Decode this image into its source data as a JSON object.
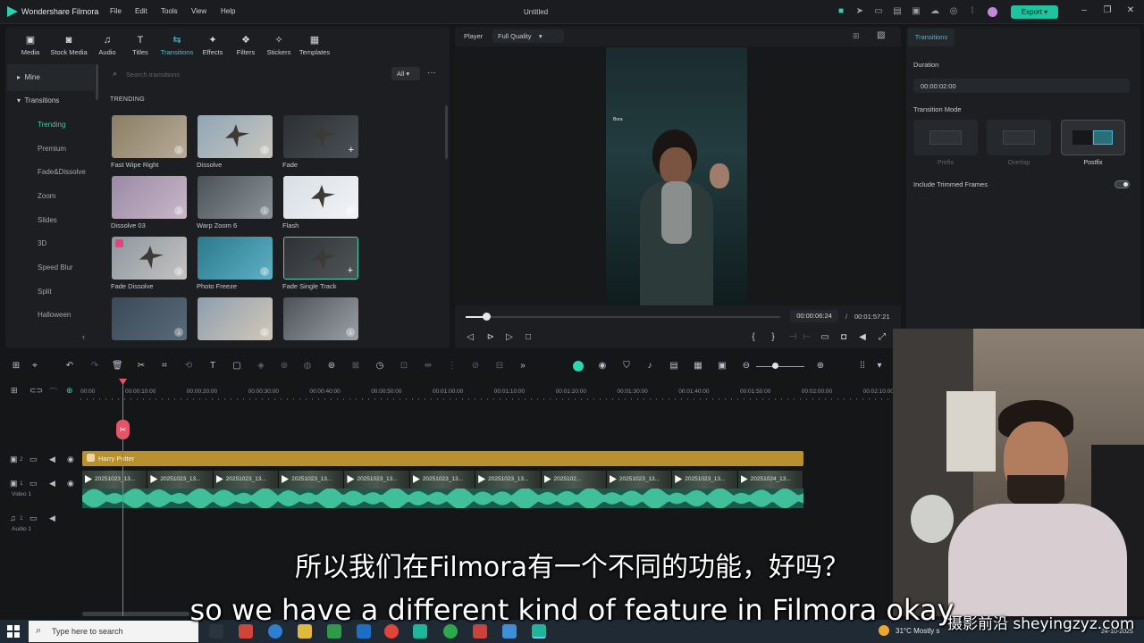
{
  "app": {
    "name": "Wondershare Filmora",
    "window_title": "Untitled",
    "menu": [
      "File",
      "Edit",
      "Tools",
      "View",
      "Help"
    ],
    "export_label": "Export"
  },
  "media_tabs": [
    {
      "label": "Media",
      "icon": "media-icon"
    },
    {
      "label": "Stock Media",
      "icon": "stock-media-icon"
    },
    {
      "label": "Audio",
      "icon": "music-note-icon"
    },
    {
      "label": "Titles",
      "icon": "titles-icon"
    },
    {
      "label": "Transitions",
      "icon": "transitions-icon"
    },
    {
      "label": "Effects",
      "icon": "effects-icon"
    },
    {
      "label": "Filters",
      "icon": "filters-icon"
    },
    {
      "label": "Stickers",
      "icon": "stickers-icon"
    },
    {
      "label": "Templates",
      "icon": "templates-icon"
    }
  ],
  "sidebar": {
    "mine": "Mine",
    "transitions": "Transitions",
    "items": [
      "Trending",
      "Premium",
      "Fade&Dissolve",
      "Zoom",
      "Slides",
      "3D",
      "Speed Blur",
      "Split",
      "Halloween"
    ]
  },
  "search": {
    "placeholder": "Search transitions",
    "filter": "All"
  },
  "trending_heading": "TRENDING",
  "thumbnails": [
    {
      "label": "Fast Wipe Right",
      "colors": [
        "#8a7e62",
        "#b7aa9a"
      ]
    },
    {
      "label": "Dissolve",
      "colors": [
        "#8fa6b6",
        "#c9c6bf"
      ]
    },
    {
      "label": "Fade",
      "colors": [
        "#2c3034",
        "#4a5056"
      ]
    },
    {
      "label": "Dissolve 03",
      "colors": [
        "#9a8aa6",
        "#c9b8c8"
      ]
    },
    {
      "label": "Warp Zoom 6",
      "colors": [
        "#4a5258",
        "#8c949a"
      ]
    },
    {
      "label": "Flash",
      "colors": [
        "#d8dee6",
        "#f2f4f6"
      ]
    },
    {
      "label": "Fade Dissolve",
      "colors": [
        "#8d96a0",
        "#c4c4c0"
      ]
    },
    {
      "label": "Photo Freeze",
      "colors": [
        "#2a7a8a",
        "#5fb0c6"
      ]
    },
    {
      "label": "Fade Single Track",
      "colors": [
        "#2e3236",
        "#505558"
      ]
    },
    {
      "label": "",
      "colors": [
        "#3a4a58",
        "#5a6a78"
      ]
    },
    {
      "label": "",
      "colors": [
        "#8d9eb0",
        "#d2c8b8"
      ]
    },
    {
      "label": "",
      "colors": [
        "#4c5258",
        "#9aa0a6"
      ]
    }
  ],
  "player": {
    "label": "Player",
    "quality": "Full Quality",
    "current_time": "00:00:06:24",
    "separator": "/",
    "total_time": "00:01:57:21",
    "progress": 0.065,
    "video_overlay_text": "Bora"
  },
  "properties": {
    "tab": "Transitions",
    "duration_label": "Duration",
    "duration_value": "00:00:02:00",
    "mode_label": "Transition Mode",
    "modes": [
      "Prefix",
      "Overlap",
      "Postfix"
    ],
    "active_mode": "Postfix",
    "include_trimmed": "Include Trimmed Frames"
  },
  "timeline": {
    "ruler": [
      "00:00",
      "00:00:10:00",
      "00:00:20:00",
      "00:00:30:00",
      "00:00:40:00",
      "00:00:50:00",
      "00:01:00:00",
      "00:01:10:00",
      "00:01:20:00",
      "00:01:30:00",
      "00:01:40:00",
      "00:01:50:00",
      "00:02:00:00",
      "00:02:10:00"
    ],
    "title_clip": "Harry Potter",
    "video_clips": [
      "20251023_13...",
      "20251023_13...",
      "20251023_13...",
      "20251023_13...",
      "20251023_13...",
      "20251023_13...",
      "20251023_13...",
      "2025102...",
      "20251023_13...",
      "20251023_13...",
      "20251024_13..."
    ],
    "track_video": "Video 1",
    "track_audio": "Audio 1",
    "track_numbers": [
      "2",
      "1",
      "1"
    ]
  },
  "subtitles": {
    "chinese": "所以我们在Filmora有一个不同的功能，好吗？",
    "english": "so we have a different kind of feature in Filmora okay",
    "watermark": "摄影前沿 sheyingzyz.com"
  },
  "taskbar": {
    "search_placeholder": "Type here to search",
    "weather": "31°C  Mostly s",
    "date": "24-10-2025"
  }
}
